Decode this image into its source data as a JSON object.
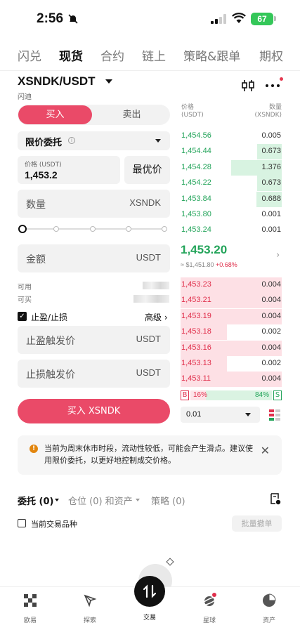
{
  "status_bar": {
    "time": "2:56",
    "battery": "67"
  },
  "top_tabs": [
    "闪兑",
    "现货",
    "合约",
    "链上",
    "策略&跟单",
    "期权"
  ],
  "active_top_tab": "现货",
  "pair": {
    "symbol": "XSNDK/USDT",
    "subtitle": "闪迪"
  },
  "trade_toggle": {
    "buy": "买入",
    "sell": "卖出"
  },
  "order_type": "限价委托",
  "price_field": {
    "label": "价格 (USDT)",
    "value": "1,453.2"
  },
  "best_price_label": "最优价",
  "qty_field": {
    "placeholder": "数量",
    "unit": "XSNDK"
  },
  "amount_field": {
    "placeholder": "金额",
    "unit": "USDT"
  },
  "slider_level": 0,
  "available_label": "可用",
  "can_buy_label": "可买",
  "tpsl": {
    "label": "止盈/止损",
    "advanced": "高级 ›"
  },
  "tp_field": {
    "placeholder": "止盈触发价",
    "unit": "USDT"
  },
  "sl_field": {
    "placeholder": "止损触发价",
    "unit": "USDT"
  },
  "buy_button": "买入 XSNDK",
  "orderbook": {
    "price_header": "价格\n(USDT)",
    "price_header_1": "价格",
    "price_header_2": "(USDT)",
    "qty_header_1": "数量",
    "qty_header_2": "(XSNDK)",
    "bids": [
      {
        "price": "1,454.56",
        "qty": "0.005",
        "depth": 0.0
      },
      {
        "price": "1,454.44",
        "qty": "0.673",
        "depth": 0.49
      },
      {
        "price": "1,454.28",
        "qty": "1.376",
        "depth": 1.0
      },
      {
        "price": "1,454.22",
        "qty": "0.673",
        "depth": 0.49
      },
      {
        "price": "1,453.84",
        "qty": "0.688",
        "depth": 0.5
      },
      {
        "price": "1,453.80",
        "qty": "0.001",
        "depth": 0.0
      },
      {
        "price": "1,453.24",
        "qty": "0.001",
        "depth": 0.0
      }
    ],
    "last_price": "1,453.20",
    "last_price_fiat": "≈ $1,451.80",
    "last_change": "+0.68%",
    "asks": [
      {
        "price": "1,453.23",
        "qty": "0.004",
        "depth": 1.0
      },
      {
        "price": "1,453.21",
        "qty": "0.004",
        "depth": 1.0
      },
      {
        "price": "1,453.19",
        "qty": "0.004",
        "depth": 1.0
      },
      {
        "price": "1,453.18",
        "qty": "0.002",
        "depth": 0.5
      },
      {
        "price": "1,453.16",
        "qty": "0.004",
        "depth": 1.0
      },
      {
        "price": "1,453.13",
        "qty": "0.002",
        "depth": 0.5
      },
      {
        "price": "1,453.11",
        "qty": "0.004",
        "depth": 1.0
      }
    ],
    "ratio": {
      "buy_label": "B",
      "buy_pct": "16%",
      "sell_label": "S",
      "sell_pct": "84%"
    },
    "precision": "0.01"
  },
  "notice": "当前为周末休市时段，流动性较低，可能会产生滑点。建议使用限价委托，以更好地控制成交价格。",
  "bottom_tabs": {
    "orders": "委托 (0)",
    "positions": "仓位 (0) 和资产",
    "strategy": "策略 (0)"
  },
  "current_pair_only": "当前交易品种",
  "batch_cancel": "批量撤单",
  "nav": [
    "欧易",
    "探索",
    "交易",
    "星球",
    "资产"
  ],
  "colors": {
    "buy": "#ea4a68",
    "green": "#23a45a",
    "red": "#e0304c"
  }
}
